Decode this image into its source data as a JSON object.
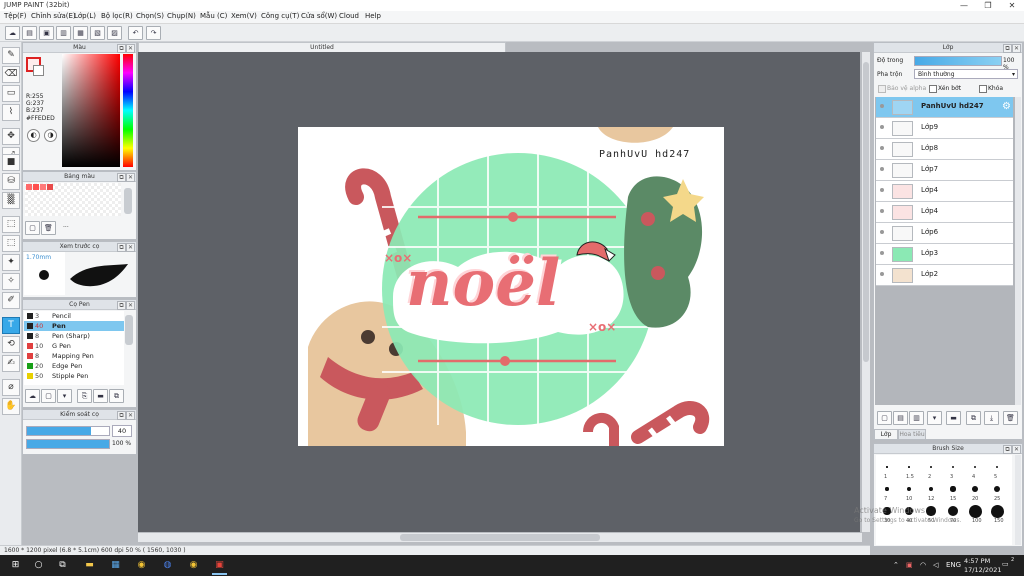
{
  "window": {
    "title": "JUMP PAINT (32bit)",
    "minimize": "—",
    "restore": "❐",
    "close": "✕"
  },
  "menu": [
    "Tệp(F)",
    "Chỉnh sửa(E)",
    "Lớp(L)",
    "Bộ lọc(R)",
    "Chọn(S)",
    "Chụp(N)",
    "Mẫu (C)",
    "Xem(V)",
    "Công cụ(T)",
    "Cửa sổ(W)",
    "Cloud",
    "Help"
  ],
  "document": {
    "tab_title": "Untitled"
  },
  "panels": {
    "color": {
      "title": "Màu",
      "r": "R:255",
      "g": "G:237",
      "b": "B:237",
      "hex": "#FFEDED"
    },
    "palette": {
      "title": "Bảng màu",
      "more": "···"
    },
    "brush_preview": {
      "title": "Xem trước cọ",
      "size": "1.70mm"
    },
    "brushes": {
      "title": "Cọ Pen",
      "items": [
        {
          "size": "3",
          "name": "Pencil",
          "color": "#222222"
        },
        {
          "size": "40",
          "name": "Pen",
          "color": "#222222"
        },
        {
          "size": "8",
          "name": "Pen (Sharp)",
          "color": "#222222"
        },
        {
          "size": "10",
          "name": "G Pen",
          "color": "#e04040"
        },
        {
          "size": "8",
          "name": "Mapping Pen",
          "color": "#e04040"
        },
        {
          "size": "20",
          "name": "Edge Pen",
          "color": "#18a018"
        },
        {
          "size": "50",
          "name": "Stipple Pen",
          "color": "#e8d000"
        }
      ]
    },
    "brush_control": {
      "title": "Kiểm soát cọ",
      "size_value": "40",
      "opacity_label": "100 %",
      "size_level": 0.78,
      "opacity_level": 1.0
    },
    "layers": {
      "title": "Lớp",
      "opacity_label": "Độ trong",
      "opacity_value": "100 %",
      "blend_label": "Pha trộn",
      "blend_value": "Bình thường",
      "protect_alpha": "Bảo vệ alpha",
      "clipping": "Xén bớt",
      "lock": "Khóa",
      "items": [
        {
          "name": "PanhUvU  hd247"
        },
        {
          "name": "Lớp9"
        },
        {
          "name": "Lớp8"
        },
        {
          "name": "Lớp7"
        },
        {
          "name": "Lớp4"
        },
        {
          "name": "Lớp4"
        },
        {
          "name": "Lớp6"
        },
        {
          "name": "Lớp3"
        },
        {
          "name": "Lớp2"
        }
      ],
      "tab_layer": "Lớp",
      "tab_other": "Hoa tiêu"
    },
    "brush_size": {
      "title": "Brush Size",
      "labels": [
        "1",
        "1.5",
        "2",
        "3",
        "4",
        "5",
        "7",
        "10",
        "12",
        "15",
        "20",
        "25",
        "30",
        "40",
        "50",
        "70",
        "100",
        "150"
      ]
    }
  },
  "canvas_art": {
    "signature": "PanhUvU  hd247",
    "main_text": "noël",
    "xo_left": "×o×",
    "xo_right": "×o×"
  },
  "status": {
    "text": "1600 * 1200 pixel  (6.8 * 5.1cm)  600 dpi  50 %  ( 1560, 1030 )"
  },
  "watermark": {
    "line1": "Activate Windows",
    "line2": "Go to Settings to activate Windows."
  },
  "taskbar": {
    "time": "4:57 PM",
    "date": "17/12/2021",
    "lang": "ENG",
    "notif": "2"
  },
  "colors": {
    "accent": "#38a8e8",
    "layer_active": "#7ec7ef",
    "canvas_bg": "#5e6167",
    "mint": "#8be9b4",
    "coral": "#e36b6b"
  }
}
